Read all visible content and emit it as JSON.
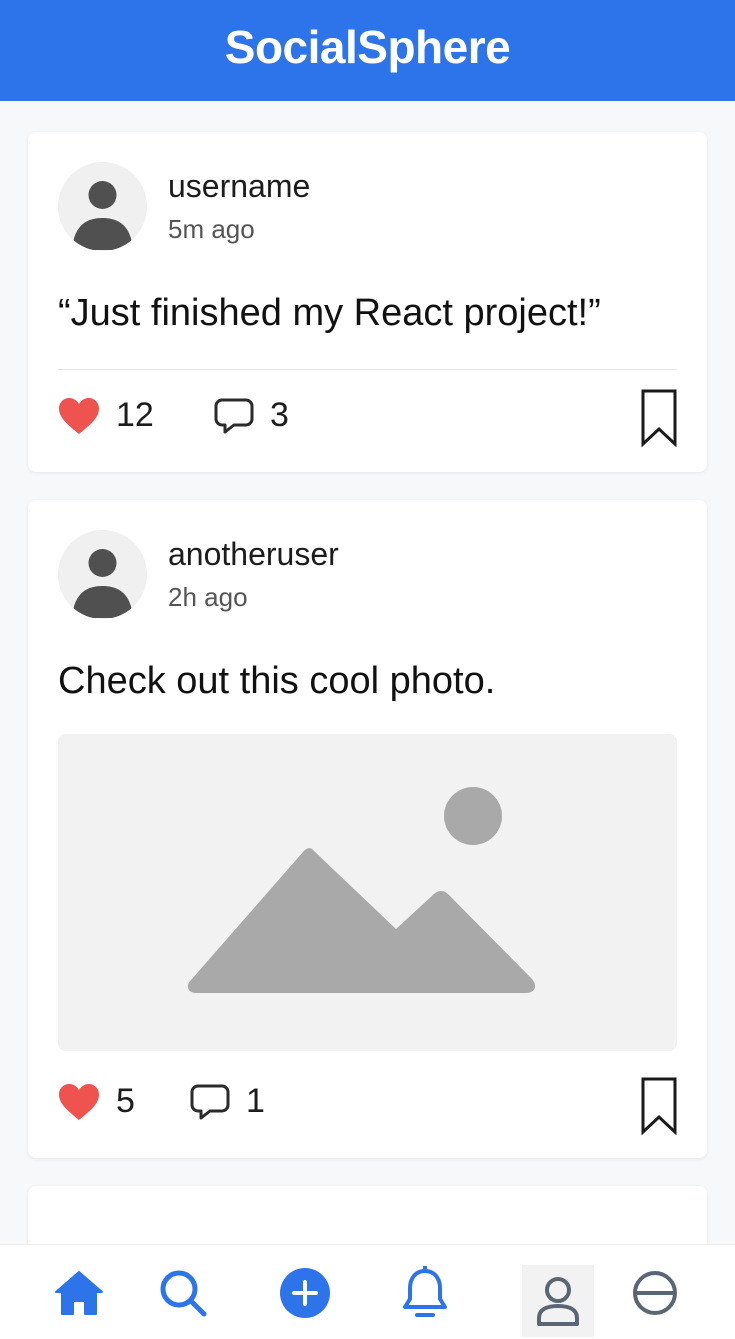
{
  "app": {
    "title": "SocialSphere",
    "colors": {
      "accent": "#2d74ea",
      "like": "#ee5350",
      "placeholder": "#a9a9a9"
    }
  },
  "posts": [
    {
      "username": "username",
      "time": "5m ago",
      "text": "“Just finished my React project!”",
      "likes": "12",
      "comments": "3",
      "has_image": false
    },
    {
      "username": "anotheruser",
      "time": "2h ago",
      "text": "Check out this cool photo.",
      "likes": "5",
      "comments": "1",
      "has_image": true
    }
  ],
  "icons": {
    "avatar": "user-avatar-icon",
    "like": "heart-icon",
    "comment": "speech-bubble-icon",
    "save": "bookmark-icon",
    "photo": "image-placeholder-icon"
  },
  "bottom_nav": [
    {
      "name": "home",
      "icon": "home-icon",
      "active": true
    },
    {
      "name": "search",
      "icon": "search-icon"
    },
    {
      "name": "create",
      "icon": "plus-circle-icon"
    },
    {
      "name": "notifications",
      "icon": "bell-icon"
    },
    {
      "name": "profile",
      "icon": "user-icon"
    },
    {
      "name": "more",
      "icon": "minus-circle-icon"
    }
  ]
}
